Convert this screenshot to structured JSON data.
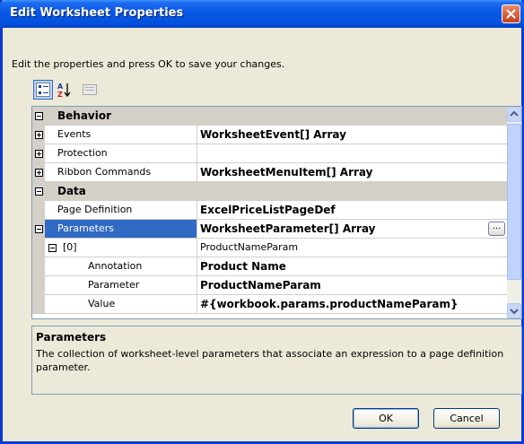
{
  "window": {
    "title": "Edit Worksheet Properties"
  },
  "instructions": "Edit the properties and press OK to save your changes.",
  "toolbar": {
    "buttons": [
      {
        "icon": "categorized-icon"
      },
      {
        "icon": "alphabetical-sort-icon"
      },
      {
        "icon": "property-pages-icon"
      }
    ]
  },
  "grid": {
    "rows": [
      {
        "kind": "category",
        "label": "Behavior",
        "expander": "minus"
      },
      {
        "kind": "prop",
        "name": "Events",
        "value": "WorksheetEvent[] Array",
        "expander": "plus",
        "bold": true
      },
      {
        "kind": "prop",
        "name": "Protection",
        "value": "",
        "expander": "plus",
        "bold": false
      },
      {
        "kind": "prop",
        "name": "Ribbon Commands",
        "value": "WorksheetMenuItem[] Array",
        "expander": "plus",
        "bold": true
      },
      {
        "kind": "category",
        "label": "Data",
        "expander": "minus"
      },
      {
        "kind": "prop",
        "name": "Page Definition",
        "value": "ExcelPriceListPageDef",
        "expander": "",
        "bold": true
      },
      {
        "kind": "prop",
        "name": "Parameters",
        "value": "WorksheetParameter[] Array",
        "expander": "minus",
        "bold": true,
        "selected": true,
        "ellipsis": "..."
      },
      {
        "kind": "sub",
        "name": "[0]",
        "value": "ProductNameParam",
        "expander": "minus",
        "bold": false
      },
      {
        "kind": "leaf",
        "name": "Annotation",
        "value": "Product Name",
        "bold": true
      },
      {
        "kind": "leaf",
        "name": "Parameter",
        "value": "ProductNameParam",
        "bold": true
      },
      {
        "kind": "leaf",
        "name": "Value",
        "value": "#{workbook.params.productNameParam}",
        "bold": true
      }
    ]
  },
  "description": {
    "title": "Parameters",
    "text": "The collection of worksheet-level parameters that associate an expression to a page definition parameter."
  },
  "buttons": {
    "ok": "OK",
    "cancel": "Cancel"
  },
  "colors": {
    "titlebar": "#0758e6",
    "selection": "#316ac5",
    "dialog": "#ece9d8"
  }
}
